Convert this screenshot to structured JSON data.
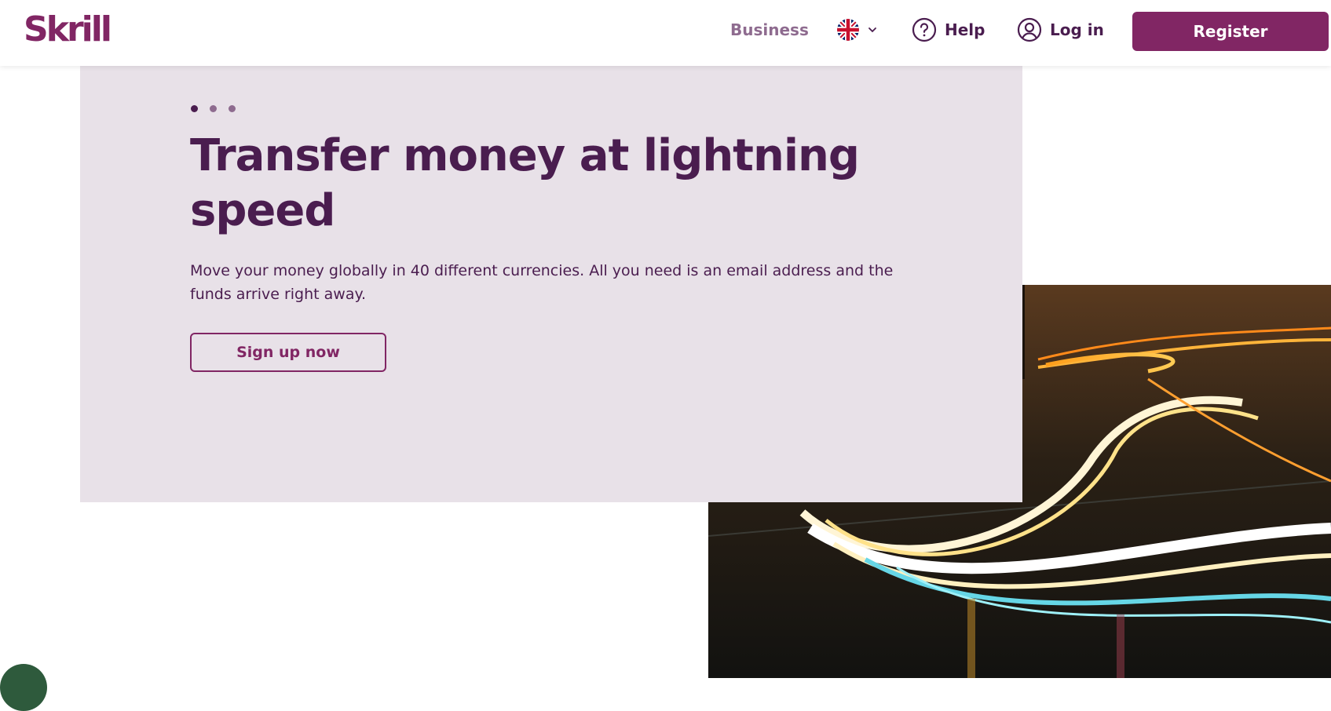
{
  "header": {
    "logo_text": "Skrill",
    "business_label": "Business",
    "language": {
      "flag": "uk-flag-icon",
      "chevron": "chevron-down-icon"
    },
    "help_label": "Help",
    "login_label": "Log in",
    "register_label": "Register"
  },
  "hero": {
    "title": "Transfer money at lightning speed",
    "description": "Move your money globally in 40 different currencies. All you need is an email address and the funds arrive right away.",
    "cta_label": "Sign up now",
    "carousel_dots": 3,
    "carousel_active": 1
  },
  "colors": {
    "brand": "#812664",
    "text": "#4a1d4f",
    "panel": "#e8e1e8",
    "muted": "#8e6b8f"
  }
}
